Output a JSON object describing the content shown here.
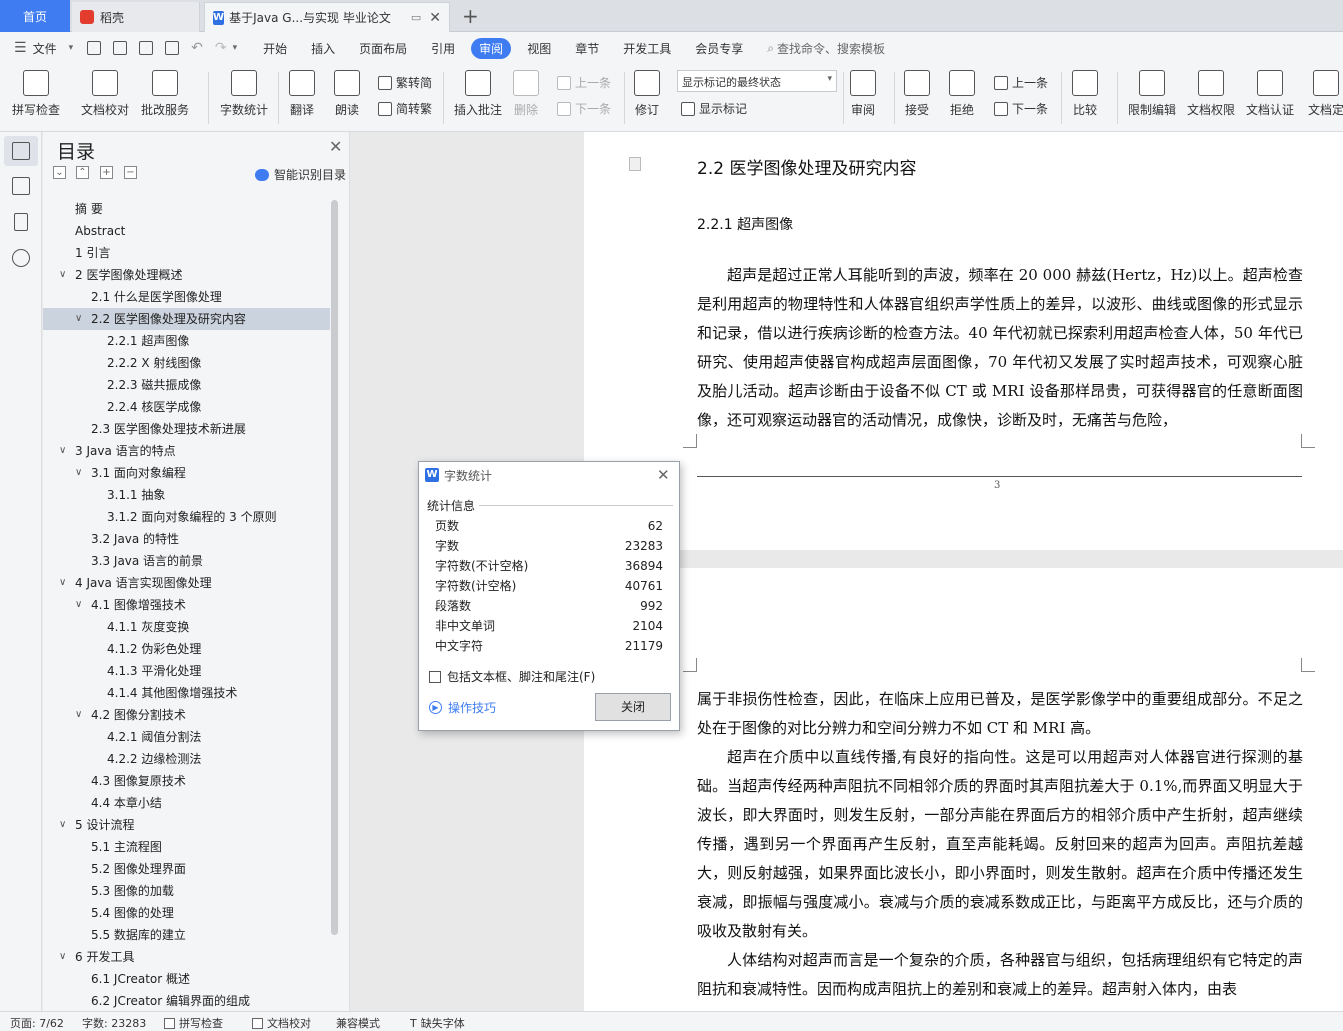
{
  "tabs": {
    "home": "首页",
    "docer": "稻壳",
    "doc_title": "基于Java G...与实现 毕业论文"
  },
  "menu": {
    "file": "文件",
    "items": [
      "开始",
      "插入",
      "页面布局",
      "引用",
      "审阅",
      "视图",
      "章节",
      "开发工具",
      "会员专享"
    ],
    "active": "审阅",
    "search": "查找命令、搜索模板"
  },
  "ribbon": {
    "spellcheck": "拼写检查",
    "proofread": "文档校对",
    "batch": "批改服务",
    "wordcount": "字数统计",
    "translate": "翻译",
    "read": "朗读",
    "trad": "繁转简",
    "simp": "简转繁",
    "insert_comment": "插入批注",
    "delete": "删除",
    "prev": "上一条",
    "next": "下一条",
    "track": "修订",
    "markup_state": "显示标记的最终状态",
    "show_markup": "显示标记",
    "review": "审阅",
    "accept": "接受",
    "reject": "拒绝",
    "prev2": "上一条",
    "next2": "下一条",
    "compare": "比较",
    "restrict": "限制编辑",
    "permission": "文档权限",
    "certify": "文档认证",
    "finalize": "文档定"
  },
  "toc": {
    "title": "目录",
    "smart": "智能识别目录",
    "items": [
      {
        "t": "摘  要",
        "lv": 1,
        "ch": false
      },
      {
        "t": "Abstract",
        "lv": 1,
        "ch": false
      },
      {
        "t": "1   引言",
        "lv": 1,
        "ch": false
      },
      {
        "t": "2   医学图像处理概述",
        "lv": 1,
        "ch": true
      },
      {
        "t": "2.1   什么是医学图像处理",
        "lv": 2,
        "ch": false
      },
      {
        "t": "2.2   医学图像处理及研究内容",
        "lv": 2,
        "ch": true,
        "sel": true
      },
      {
        "t": "2.2.1   超声图像",
        "lv": 3,
        "ch": false
      },
      {
        "t": "2.2.2   X 射线图像",
        "lv": 3,
        "ch": false
      },
      {
        "t": "2.2.3   磁共振成像",
        "lv": 3,
        "ch": false
      },
      {
        "t": "2.2.4   核医学成像",
        "lv": 3,
        "ch": false
      },
      {
        "t": "2.3   医学图像处理技术新进展",
        "lv": 2,
        "ch": false
      },
      {
        "t": "3   Java 语言的特点",
        "lv": 1,
        "ch": true
      },
      {
        "t": "3.1   面向对象编程",
        "lv": 2,
        "ch": true
      },
      {
        "t": "3.1.1   抽象",
        "lv": 3,
        "ch": false
      },
      {
        "t": "3.1.2   面向对象编程的 3 个原则",
        "lv": 3,
        "ch": false
      },
      {
        "t": "3.2   Java 的特性",
        "lv": 2,
        "ch": false
      },
      {
        "t": "3.3   Java 语言的前景",
        "lv": 2,
        "ch": false
      },
      {
        "t": "4   Java 语言实现图像处理",
        "lv": 1,
        "ch": true
      },
      {
        "t": "4.1   图像增强技术",
        "lv": 2,
        "ch": true
      },
      {
        "t": "4.1.1   灰度变换",
        "lv": 3,
        "ch": false
      },
      {
        "t": "4.1.2   伪彩色处理",
        "lv": 3,
        "ch": false
      },
      {
        "t": "4.1.3   平滑化处理",
        "lv": 3,
        "ch": false
      },
      {
        "t": "4.1.4   其他图像增强技术",
        "lv": 3,
        "ch": false
      },
      {
        "t": "4.2   图像分割技术",
        "lv": 2,
        "ch": true
      },
      {
        "t": "4.2.1   阈值分割法",
        "lv": 3,
        "ch": false
      },
      {
        "t": "4.2.2   边缘检测法",
        "lv": 3,
        "ch": false
      },
      {
        "t": "4.3   图像复原技术",
        "lv": 2,
        "ch": false
      },
      {
        "t": "4.4   本章小结",
        "lv": 2,
        "ch": false
      },
      {
        "t": "5   设计流程",
        "lv": 1,
        "ch": true
      },
      {
        "t": "5.1   主流程图",
        "lv": 2,
        "ch": false
      },
      {
        "t": "5.2   图像处理界面",
        "lv": 2,
        "ch": false
      },
      {
        "t": "5.3   图像的加载",
        "lv": 2,
        "ch": false
      },
      {
        "t": "5.4   图像的处理",
        "lv": 2,
        "ch": false
      },
      {
        "t": "5.5   数据库的建立",
        "lv": 2,
        "ch": false
      },
      {
        "t": "6   开发工具",
        "lv": 1,
        "ch": true
      },
      {
        "t": "6.1   JCreator 概述",
        "lv": 2,
        "ch": false
      },
      {
        "t": "6.2   JCreator 编辑界面的组成",
        "lv": 2,
        "ch": false
      }
    ]
  },
  "document": {
    "h22": "2.2    医学图像处理及研究内容",
    "h221": "2.2.1    超声图像",
    "p1": "超声是超过正常人耳能听到的声波，频率在 20 000 赫兹(Hertz，Hz)以上。超声检查是利用超声的物理特性和人体器官组织声学性质上的差异，以波形、曲线或图像的形式显示和记录，借以进行疾病诊断的检查方法。40 年代初就已探索利用超声检查人体，50 年代已研究、使用超声使器官构成超声层面图像，70 年代初又发展了实时超声技术，可观察心脏及胎儿活动。超声诊断由于设备不似 CT 或 MRI 设备那样昂贵，可获得器官的任意断面图像，还可观察运动器官的活动情况，成像快，诊断及时，无痛苦与危险，",
    "page_number": "3",
    "p2": "属于非损伤性检查，因此，在临床上应用已普及，是医学影像学中的重要组成部分。不足之处在于图像的对比分辨力和空间分辨力不如 CT 和 MRI 高。",
    "p3": "超声在介质中以直线传播,有良好的指向性。这是可以用超声对人体器官进行探测的基础。当超声传经两种声阻抗不同相邻介质的界面时其声阻抗差大于 0.1%,而界面又明显大于波长，即大界面时，则发生反射，一部分声能在界面后方的相邻介质中产生折射，超声继续传播，遇到另一个界面再产生反射，直至声能耗竭。反射回来的超声为回声。声阻抗差越大，则反射越强，如果界面比波长小，即小界面时，则发生散射。超声在介质中传播还发生衰减，即振幅与强度减小。衰减与介质的衰减系数成正比，与距离平方成反比，还与介质的吸收及散射有关。",
    "p4": "人体结构对超声而言是一个复杂的介质，各种器官与组织，包括病理组织有它特定的声阻抗和衰减特性。因而构成声阻抗上的差别和衰减上的差异。超声射入体内，由表"
  },
  "dialog": {
    "title": "字数统计",
    "group": "统计信息",
    "rows": [
      {
        "k": "页数",
        "v": "62"
      },
      {
        "k": "字数",
        "v": "23283"
      },
      {
        "k": "字符数(不计空格)",
        "v": "36894"
      },
      {
        "k": "字符数(计空格)",
        "v": "40761"
      },
      {
        "k": "段落数",
        "v": "992"
      },
      {
        "k": "非中文单词",
        "v": "2104"
      },
      {
        "k": "中文字符",
        "v": "21179"
      }
    ],
    "include": "包括文本框、脚注和尾注(F)",
    "tips": "操作技巧",
    "close": "关闭"
  },
  "status": {
    "page": "页面: 7/62",
    "words": "字数: 23283",
    "spell": "拼写检查",
    "proof": "文档校对",
    "compat": "兼容模式",
    "missing_font": "缺失字体"
  }
}
